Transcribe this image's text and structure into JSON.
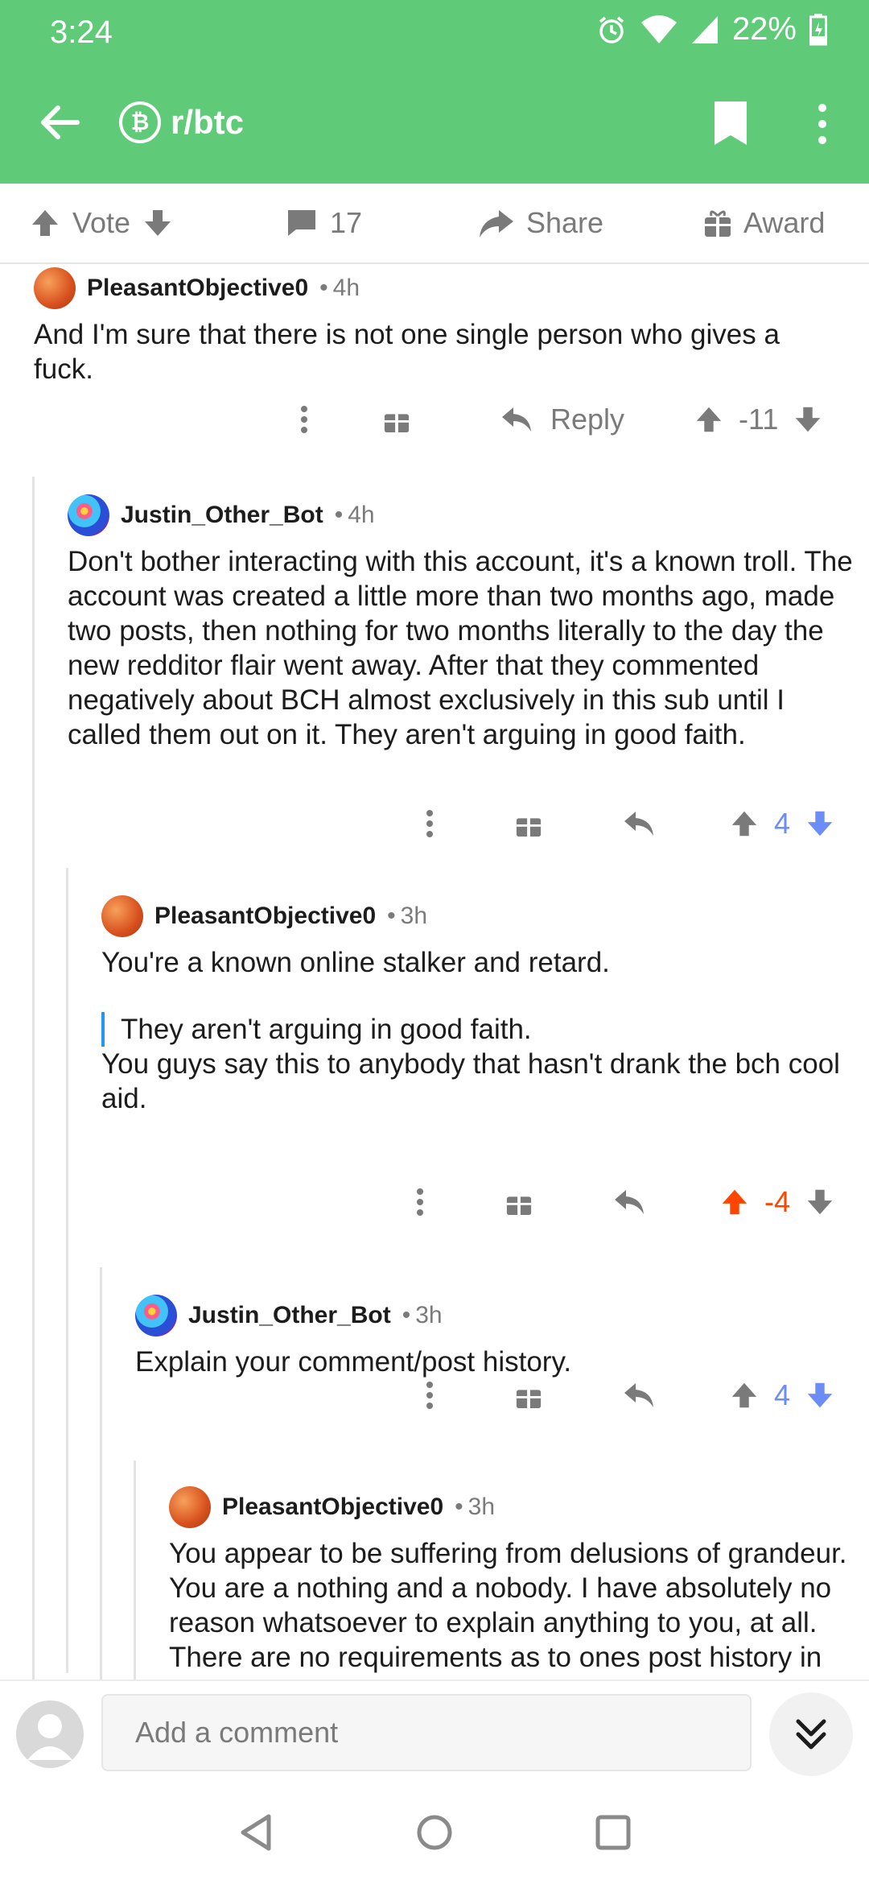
{
  "status_bar": {
    "time": "3:24",
    "battery": "22%"
  },
  "app_bar": {
    "subreddit": "r/btc"
  },
  "action_bar": {
    "vote_label": "Vote",
    "comment_count": "17",
    "share_label": "Share",
    "award_label": "Award"
  },
  "comments": [
    {
      "author": "PleasantObjective0",
      "age": "4h",
      "body": [
        "And I'm sure that there is not one single person who gives a fuck."
      ],
      "reply_label": "Reply",
      "score": "-11",
      "vote_state": "none"
    },
    {
      "author": "Justin_Other_Bot",
      "age": "4h",
      "body": [
        "Don't bother interacting with this account, it's a known troll. The account was created a little more than two months ago, made two posts, then nothing for two months literally to the day the new redditor flair went away. After that they commented negatively about BCH almost exclusively in this sub until I called them out on it. They aren't arguing in good faith."
      ],
      "score": "4",
      "vote_state": "down"
    },
    {
      "author": "PleasantObjective0",
      "age": "3h",
      "body": [
        "You're a known online stalker and retard.",
        "You guys say this to anybody that hasn't drank the bch cool aid."
      ],
      "quote": "They aren't arguing in good faith.",
      "score": "-4",
      "vote_state": "up"
    },
    {
      "author": "Justin_Other_Bot",
      "age": "3h",
      "body": [
        "Explain your comment/post history."
      ],
      "score": "4",
      "vote_state": "down"
    },
    {
      "author": "PleasantObjective0",
      "age": "3h",
      "body": [
        "You appear to be suffering from delusions of grandeur.  You are a nothing and a nobody.  I have absolutely no reason whatsoever to explain anything to you, at all.  There are no requirements as to ones post history in order to be able to post in"
      ]
    }
  ],
  "composer": {
    "placeholder": "Add a comment"
  },
  "colors": {
    "brand": "#5fca78",
    "upvoted": "#ff4500",
    "downvoted": "#6c8df5",
    "quote_bar": "#2196f3"
  }
}
